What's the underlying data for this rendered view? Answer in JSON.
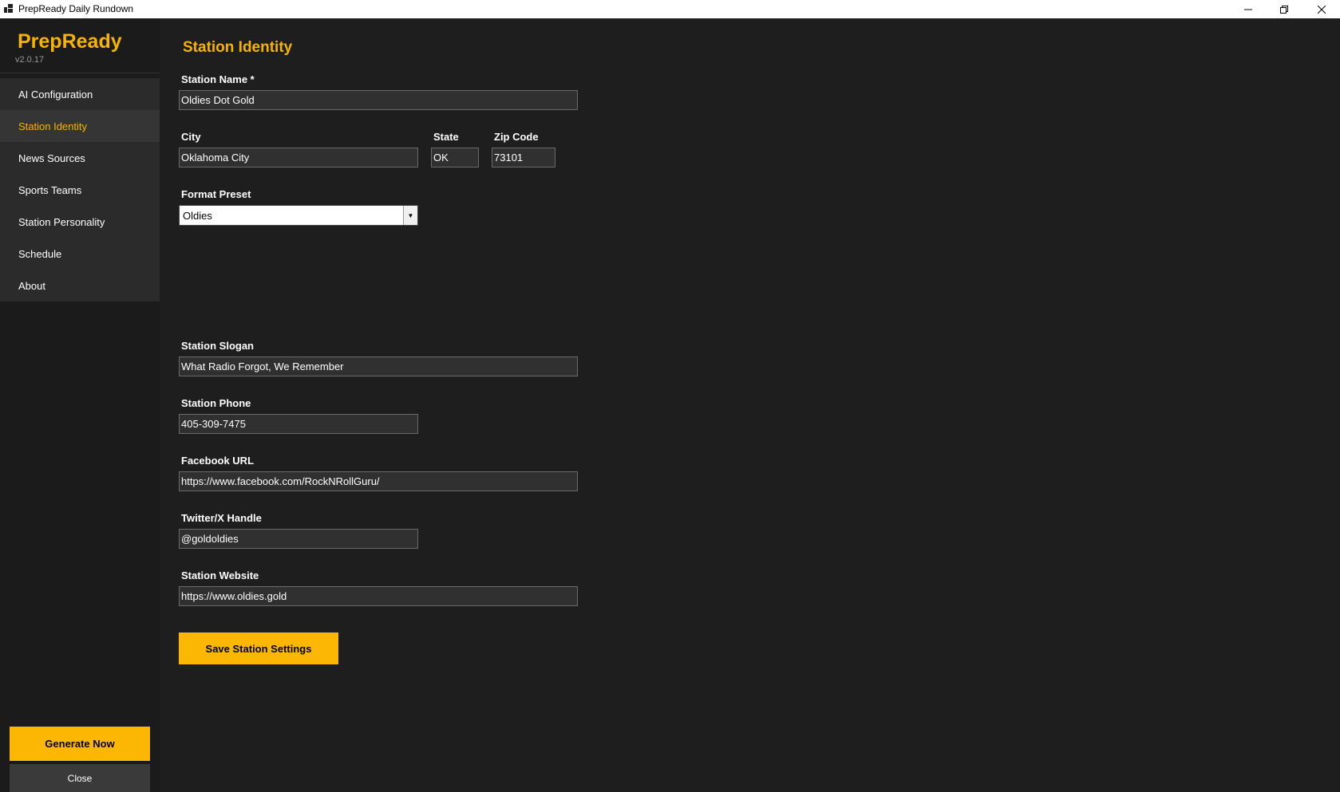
{
  "window": {
    "title": "PrepReady Daily Rundown",
    "icons": [
      "app-icon",
      "minimize-icon",
      "maximize-icon",
      "close-icon"
    ]
  },
  "sidebar": {
    "brand": "PrepReady",
    "version": "v2.0.17",
    "items": [
      {
        "label": "AI Configuration",
        "active": false
      },
      {
        "label": "Station Identity",
        "active": true
      },
      {
        "label": "News Sources",
        "active": false
      },
      {
        "label": "Sports Teams",
        "active": false
      },
      {
        "label": "Station Personality",
        "active": false
      },
      {
        "label": "Schedule",
        "active": false
      },
      {
        "label": "About",
        "active": false
      }
    ],
    "generate_label": "Generate Now",
    "close_label": "Close"
  },
  "main": {
    "title": "Station Identity",
    "station_name": {
      "label": "Station Name *",
      "value": "Oldies Dot Gold"
    },
    "city": {
      "label": "City",
      "value": "Oklahoma City"
    },
    "state": {
      "label": "State",
      "value": "OK"
    },
    "zip": {
      "label": "Zip Code",
      "value": "73101"
    },
    "format_preset": {
      "label": "Format Preset",
      "value": "Oldies"
    },
    "slogan": {
      "label": "Station Slogan",
      "value": "What Radio Forgot, We Remember"
    },
    "phone": {
      "label": "Station Phone",
      "value": "405-309-7475"
    },
    "facebook": {
      "label": "Facebook URL",
      "value": "https://www.facebook.com/RockNRollGuru/"
    },
    "twitter": {
      "label": "Twitter/X Handle",
      "value": "@goldoldies"
    },
    "website": {
      "label": "Station Website",
      "value": "https://www.oldies.gold"
    },
    "save_label": "Save Station Settings"
  },
  "colors": {
    "accent": "#f6b300",
    "background": "#1e1e1e",
    "sidebar_nav": "#2b2b2b",
    "field_bg": "#303030"
  }
}
